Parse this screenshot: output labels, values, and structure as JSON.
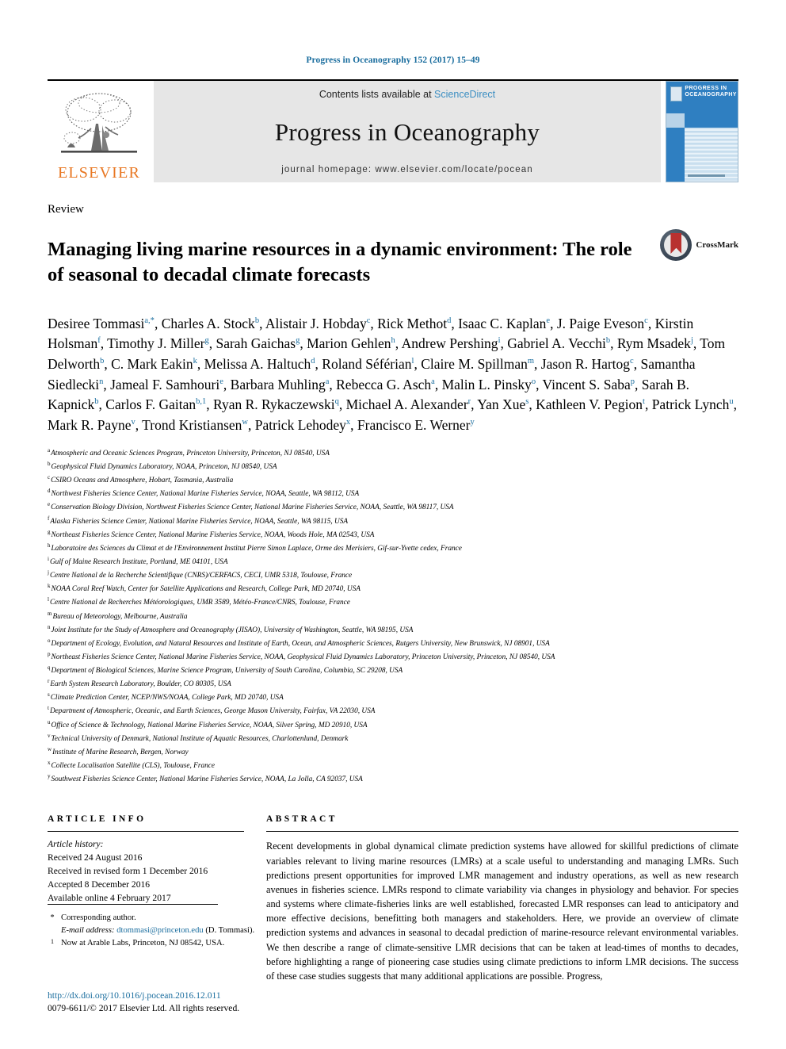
{
  "running_head": "Progress in Oceanography 152 (2017) 15–49",
  "masthead": {
    "contents_prefix": "Contents lists available at ",
    "sciencedirect": "ScienceDirect",
    "journal_name": "Progress in Oceanography",
    "homepage": "journal homepage: www.elsevier.com/locate/pocean",
    "publisher": "ELSEVIER",
    "cover_title_line1": "PROGRESS IN",
    "cover_title_line2": "OCEANOGRAPHY"
  },
  "article": {
    "type": "Review",
    "title": "Managing living marine resources in a dynamic environment: The role of seasonal to decadal climate forecasts",
    "crossmark_label": "CrossMark"
  },
  "authors": [
    {
      "name": "Desiree Tommasi",
      "sup": "a,*"
    },
    {
      "name": "Charles A. Stock",
      "sup": "b"
    },
    {
      "name": "Alistair J. Hobday",
      "sup": "c"
    },
    {
      "name": "Rick Methot",
      "sup": "d"
    },
    {
      "name": "Isaac C. Kaplan",
      "sup": "e"
    },
    {
      "name": "J. Paige Eveson",
      "sup": "c"
    },
    {
      "name": "Kirstin Holsman",
      "sup": "f"
    },
    {
      "name": "Timothy J. Miller",
      "sup": "g"
    },
    {
      "name": "Sarah Gaichas",
      "sup": "g"
    },
    {
      "name": "Marion Gehlen",
      "sup": "h"
    },
    {
      "name": "Andrew Pershing",
      "sup": "i"
    },
    {
      "name": "Gabriel A. Vecchi",
      "sup": "b"
    },
    {
      "name": "Rym Msadek",
      "sup": "j"
    },
    {
      "name": "Tom Delworth",
      "sup": "b"
    },
    {
      "name": "C. Mark Eakin",
      "sup": "k"
    },
    {
      "name": "Melissa A. Haltuch",
      "sup": "d"
    },
    {
      "name": "Roland Séférian",
      "sup": "l"
    },
    {
      "name": "Claire M. Spillman",
      "sup": "m"
    },
    {
      "name": "Jason R. Hartog",
      "sup": "c"
    },
    {
      "name": "Samantha Siedlecki",
      "sup": "n"
    },
    {
      "name": "Jameal F. Samhouri",
      "sup": "e"
    },
    {
      "name": "Barbara Muhling",
      "sup": "a"
    },
    {
      "name": "Rebecca G. Asch",
      "sup": "a"
    },
    {
      "name": "Malin L. Pinsky",
      "sup": "o"
    },
    {
      "name": "Vincent S. Saba",
      "sup": "p"
    },
    {
      "name": "Sarah B. Kapnick",
      "sup": "b"
    },
    {
      "name": "Carlos F. Gaitan",
      "sup": "b,1"
    },
    {
      "name": "Ryan R. Rykaczewski",
      "sup": "q"
    },
    {
      "name": "Michael A. Alexander",
      "sup": "r"
    },
    {
      "name": "Yan Xue",
      "sup": "s"
    },
    {
      "name": "Kathleen V. Pegion",
      "sup": "t"
    },
    {
      "name": "Patrick Lynch",
      "sup": "u"
    },
    {
      "name": "Mark R. Payne",
      "sup": "v"
    },
    {
      "name": "Trond Kristiansen",
      "sup": "w"
    },
    {
      "name": "Patrick Lehodey",
      "sup": "x"
    },
    {
      "name": "Francisco E. Werner",
      "sup": "y"
    }
  ],
  "affiliations": [
    {
      "mark": "a",
      "text": "Atmospheric and Oceanic Sciences Program, Princeton University, Princeton, NJ 08540, USA"
    },
    {
      "mark": "b",
      "text": "Geophysical Fluid Dynamics Laboratory, NOAA, Princeton, NJ 08540, USA"
    },
    {
      "mark": "c",
      "text": "CSIRO Oceans and Atmosphere, Hobart, Tasmania, Australia"
    },
    {
      "mark": "d",
      "text": "Northwest Fisheries Science Center, National Marine Fisheries Service, NOAA, Seattle, WA 98112, USA"
    },
    {
      "mark": "e",
      "text": "Conservation Biology Division, Northwest Fisheries Science Center, National Marine Fisheries Service, NOAA, Seattle, WA 98117, USA"
    },
    {
      "mark": "f",
      "text": "Alaska Fisheries Science Center, National Marine Fisheries Service, NOAA, Seattle, WA 98115, USA"
    },
    {
      "mark": "g",
      "text": "Northeast Fisheries Science Center, National Marine Fisheries Service, NOAA, Woods Hole, MA 02543, USA"
    },
    {
      "mark": "h",
      "text": "Laboratoire des Sciences du Climat et de l'Environnement Institut Pierre Simon Laplace, Orme des Merisiers, Gif-sur-Yvette cedex, France"
    },
    {
      "mark": "i",
      "text": "Gulf of Maine Research Institute, Portland, ME 04101, USA"
    },
    {
      "mark": "j",
      "text": "Centre National de la Recherche Scientifique (CNRS)/CERFACS, CECI, UMR 5318, Toulouse, France"
    },
    {
      "mark": "k",
      "text": "NOAA Coral Reef Watch, Center for Satellite Applications and Research, College Park, MD 20740, USA"
    },
    {
      "mark": "l",
      "text": "Centre National de Recherches Météorologiques, UMR 3589, Météo-France/CNRS, Toulouse, France"
    },
    {
      "mark": "m",
      "text": "Bureau of Meteorology, Melbourne, Australia"
    },
    {
      "mark": "n",
      "text": "Joint Institute for the Study of Atmosphere and Oceanography (JISAO), University of Washington, Seattle, WA 98195, USA"
    },
    {
      "mark": "o",
      "text": "Department of Ecology, Evolution, and Natural Resources and Institute of Earth, Ocean, and Atmospheric Sciences, Rutgers University, New Brunswick, NJ 08901, USA"
    },
    {
      "mark": "p",
      "text": "Northeast Fisheries Science Center, National Marine Fisheries Service, NOAA, Geophysical Fluid Dynamics Laboratory, Princeton University, Princeton, NJ 08540, USA"
    },
    {
      "mark": "q",
      "text": "Department of Biological Sciences, Marine Science Program, University of South Carolina, Columbia, SC 29208, USA"
    },
    {
      "mark": "r",
      "text": "Earth System Research Laboratory, Boulder, CO 80305, USA"
    },
    {
      "mark": "s",
      "text": "Climate Prediction Center, NCEP/NWS/NOAA, College Park, MD 20740, USA"
    },
    {
      "mark": "t",
      "text": "Department of Atmospheric, Oceanic, and Earth Sciences, George Mason University, Fairfax, VA 22030, USA"
    },
    {
      "mark": "u",
      "text": "Office of Science & Technology, National Marine Fisheries Service, NOAA, Silver Spring, MD 20910, USA"
    },
    {
      "mark": "v",
      "text": "Technical University of Denmark, National Institute of Aquatic Resources, Charlottenlund, Denmark"
    },
    {
      "mark": "w",
      "text": "Institute of Marine Research, Bergen, Norway"
    },
    {
      "mark": "x",
      "text": "Collecte Localisation Satellite (CLS), Toulouse, France"
    },
    {
      "mark": "y",
      "text": "Southwest Fisheries Science Center, National Marine Fisheries Service, NOAA, La Jolla, CA 92037, USA"
    }
  ],
  "article_info": {
    "heading": "ARTICLE INFO",
    "history_label": "Article history:",
    "received": "Received 24 August 2016",
    "revised": "Received in revised form 1 December 2016",
    "accepted": "Accepted 8 December 2016",
    "online": "Available online 4 February 2017"
  },
  "abstract": {
    "heading": "ABSTRACT",
    "text": "Recent developments in global dynamical climate prediction systems have allowed for skillful predictions of climate variables relevant to living marine resources (LMRs) at a scale useful to understanding and managing LMRs. Such predictions present opportunities for improved LMR management and industry operations, as well as new research avenues in fisheries science. LMRs respond to climate variability via changes in physiology and behavior. For species and systems where climate-fisheries links are well established, forecasted LMR responses can lead to anticipatory and more effective decisions, benefitting both managers and stakeholders. Here, we provide an overview of climate prediction systems and advances in seasonal to decadal prediction of marine-resource relevant environmental variables. We then describe a range of climate-sensitive LMR decisions that can be taken at lead-times of months to decades, before highlighting a range of pioneering case studies using climate predictions to inform LMR decisions. The success of these case studies suggests that many additional applications are possible. Progress,"
  },
  "footnotes": {
    "corresponding_mark": "*",
    "corresponding_text": "Corresponding author.",
    "email_label": "E-mail address:",
    "email": "dtommasi@princeton.edu",
    "email_suffix": "(D. Tommasi).",
    "note1_mark": "1",
    "note1_text": "Now at Arable Labs, Princeton, NJ 08542, USA."
  },
  "footer": {
    "doi": "http://dx.doi.org/10.1016/j.pocean.2016.12.011",
    "copyright": "0079-6611/© 2017 Elsevier Ltd. All rights reserved."
  },
  "colors": {
    "link_blue": "#1a6d9e",
    "elsevier_orange": "#E87722",
    "cover_blue": "#2f7fc1",
    "crossmark_red": "#b8312f"
  }
}
